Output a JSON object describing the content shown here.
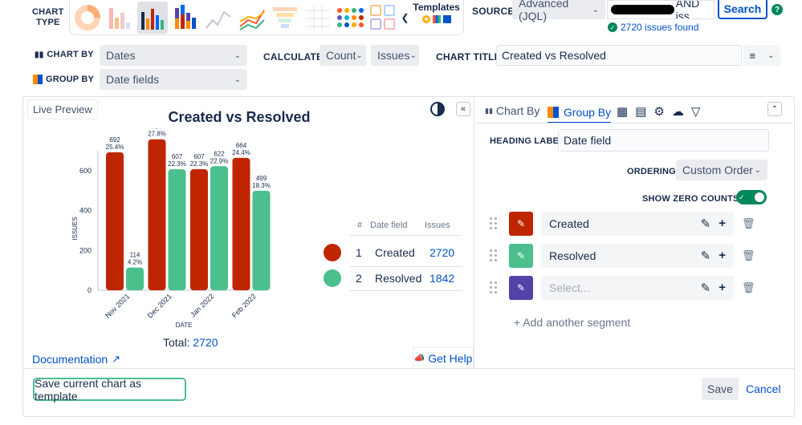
{
  "chart_type_label": [
    "CHART",
    "TYPE"
  ],
  "templates_label": "Templates",
  "source_label": "SOURCE",
  "source_select": "Advanced (JQL)",
  "jql_visible_text": "AND iss",
  "search_button": "Search",
  "issues_found": "2720 issues found",
  "chart_by_label": "CHART BY",
  "chart_by_value": "Dates",
  "calculate_label": "CALCULATE",
  "calculate_value": "Count",
  "calculate_field": "Issues",
  "chart_title_label": "CHART TITLE",
  "chart_title_value": "Created vs Resolved",
  "group_by_label": "GROUP BY",
  "group_by_value": "Date fields",
  "live_preview": "Live Preview",
  "documentation": "Documentation",
  "get_help": "Get Help",
  "save_template_button": "Save current chart as template",
  "save_button": "Save",
  "cancel_button": "Cancel",
  "panel_tabs": {
    "chart_by": "Chart By",
    "group_by": "Group By"
  },
  "heading_label_label": "HEADING LABEL",
  "heading_label_value": "Date field",
  "ordering_label": "ORDERING",
  "ordering_value": "Custom Order",
  "show_zero_counts_label": "SHOW ZERO COUNTS",
  "segments": [
    {
      "label": "Created",
      "color": "#bf2600"
    },
    {
      "label": "Resolved",
      "color": "#4bbf8c"
    },
    {
      "label": "",
      "placeholder": "Select...",
      "color": "#5243aa"
    }
  ],
  "add_segment": "+ Add another segment",
  "legend_table": {
    "headers": [
      "#",
      "Date field",
      "Issues"
    ],
    "rows": [
      {
        "num": "1",
        "name": "Created",
        "issues": "2720",
        "color": "#bf2600"
      },
      {
        "num": "2",
        "name": "Resolved",
        "issues": "1842",
        "color": "#4bbf8c"
      }
    ]
  },
  "total_label": "Total:",
  "total_value": "2720",
  "chart_data": {
    "type": "bar",
    "title": "Created vs Resolved",
    "xlabel": "DATE",
    "ylabel": "ISSUES",
    "categories": [
      "Nov 2021",
      "Dec 2021",
      "Jan 2022",
      "Feb 2022"
    ],
    "yticks": [
      0,
      200,
      400,
      600
    ],
    "ylim": [
      0,
      780
    ],
    "series": [
      {
        "name": "Created",
        "color": "#bf2600",
        "values": [
          692,
          757,
          607,
          664
        ],
        "pct": [
          "25.4%",
          "27.8%",
          "22.3%",
          "24.4%"
        ]
      },
      {
        "name": "Resolved",
        "color": "#4bbf8c",
        "values": [
          114,
          607,
          622,
          499
        ],
        "pct": [
          "4.2%",
          "22.3%",
          "22.9%",
          "18.3%"
        ]
      }
    ]
  }
}
